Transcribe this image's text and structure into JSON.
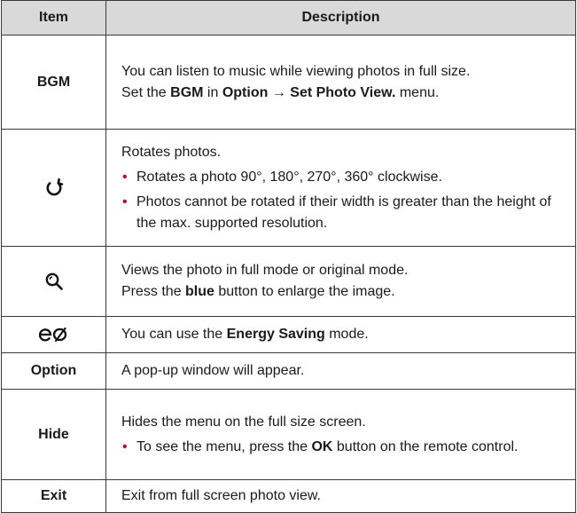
{
  "header": {
    "item": "Item",
    "description": "Description"
  },
  "rows": [
    {
      "item": "BGM",
      "desc": {
        "line1": "You can listen to music while viewing photos in full size.",
        "line2_pre": "Set the ",
        "line2_b1": "BGM",
        "line2_mid1": " in ",
        "line2_b2": "Option",
        "line2_arrow": " → ",
        "line2_b3": "Set Photo View.",
        "line2_post": " menu."
      }
    },
    {
      "icon": "rotate-icon",
      "desc": {
        "line1": "Rotates photos.",
        "bullet1": "Rotates a photo 90°, 180°, 270°, 360° clockwise.",
        "bullet2": "Photos cannot be rotated if their width is greater than the height of the max. supported resolution."
      }
    },
    {
      "icon": "zoom-icon",
      "desc": {
        "line1": "Views the photo in full mode or original mode.",
        "line2_pre": "Press the ",
        "line2_b": "blue",
        "line2_post": " button to enlarge the image."
      }
    },
    {
      "icon": "energy-saving-icon",
      "desc": {
        "pre": "You can use the ",
        "b": "Energy Saving",
        "post": " mode."
      }
    },
    {
      "item": "Option",
      "desc": {
        "line1": "A pop-up window will appear."
      }
    },
    {
      "item": "Hide",
      "desc": {
        "line1": "Hides the menu on the full size screen.",
        "bullet_pre": "To see the menu, press the ",
        "bullet_b": "OK",
        "bullet_post": " button on the remote control."
      }
    },
    {
      "item": "Exit",
      "desc": {
        "line1": "Exit from full screen photo view."
      }
    }
  ],
  "colors": {
    "header_bg": "#d9d9d9",
    "bullet": "#c8002d",
    "border": "#3a3a3a"
  }
}
